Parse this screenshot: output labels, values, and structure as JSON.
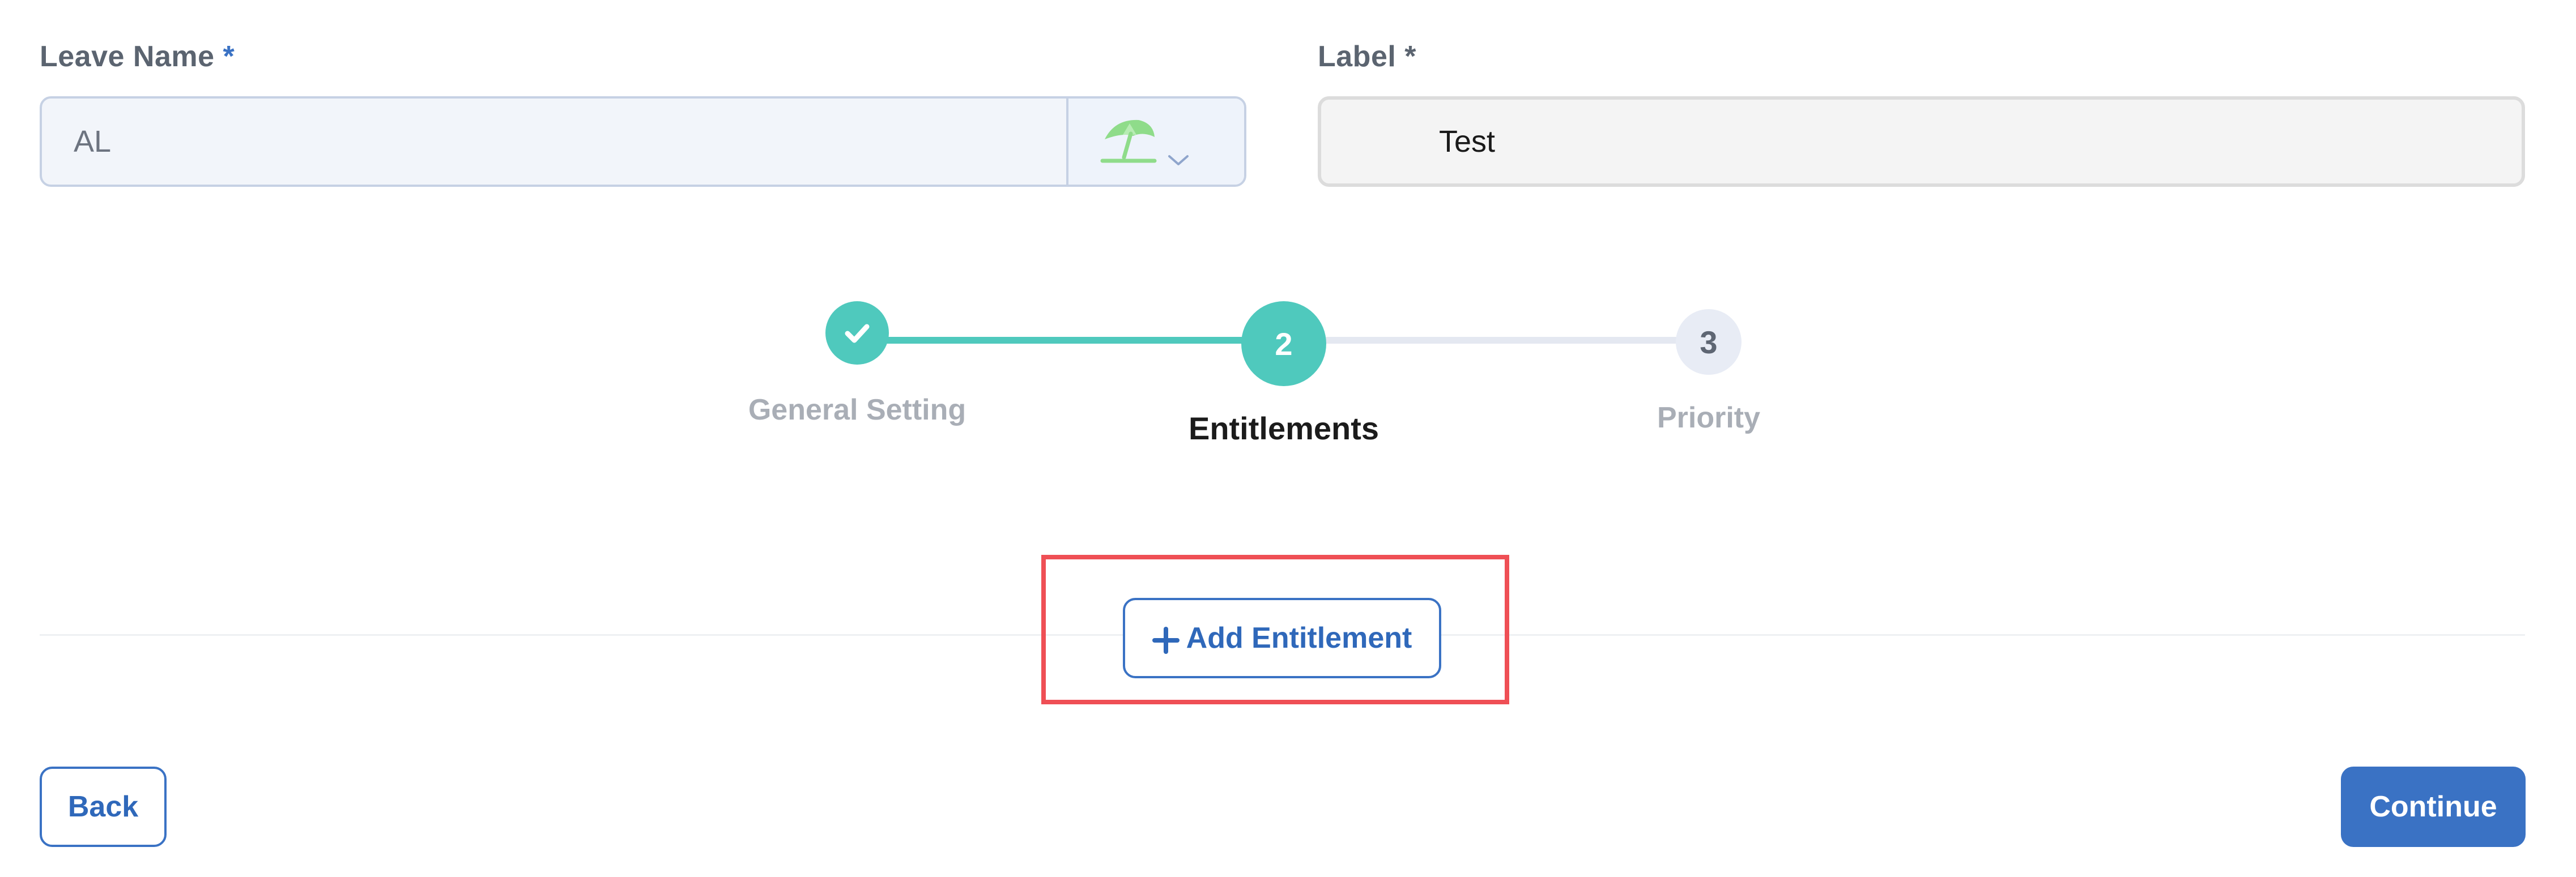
{
  "form": {
    "leave_name_label": "Leave Name",
    "leave_name_required": "*",
    "leave_name_value": "AL",
    "icon_picker_icon": "beach-umbrella-icon",
    "label_label": "Label",
    "label_required": "*",
    "label_value": "Test"
  },
  "stepper": {
    "steps": [
      {
        "label": "General Setting",
        "number": "1",
        "status": "completed"
      },
      {
        "label": "Entitlements",
        "number": "2",
        "status": "current"
      },
      {
        "label": "Priority",
        "number": "3",
        "status": "upcoming"
      }
    ]
  },
  "actions": {
    "add_entitlement_label": "Add Entitlement",
    "back_label": "Back",
    "continue_label": "Continue"
  },
  "colors": {
    "accent_blue": "#3a72c4",
    "step_teal": "#4fc9bd",
    "highlight_red": "#ef4f55",
    "umbrella_green": "#8fdc8a"
  }
}
